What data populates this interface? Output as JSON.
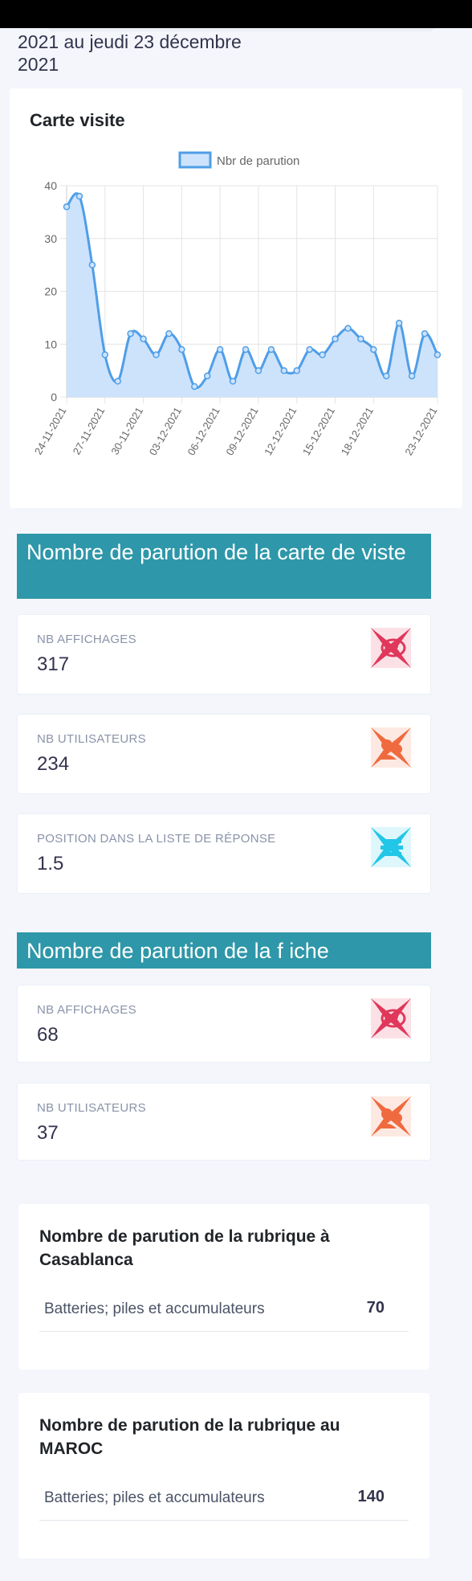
{
  "header": {
    "date_range": "2021 au jeudi 23 décembre 2021"
  },
  "visits_chart": {
    "title": "Carte visite",
    "legend_label": "Nbr de parution"
  },
  "chart_data": {
    "type": "area",
    "title": "Carte visite",
    "x": [
      "24-11-2021",
      "25-11-2021",
      "26-11-2021",
      "27-11-2021",
      "28-11-2021",
      "29-11-2021",
      "30-11-2021",
      "01-12-2021",
      "02-12-2021",
      "03-12-2021",
      "04-12-2021",
      "05-12-2021",
      "06-12-2021",
      "07-12-2021",
      "08-12-2021",
      "09-12-2021",
      "10-12-2021",
      "11-12-2021",
      "12-12-2021",
      "13-12-2021",
      "14-12-2021",
      "15-12-2021",
      "16-12-2021",
      "17-12-2021",
      "18-12-2021",
      "19-12-2021",
      "20-12-2021",
      "21-12-2021",
      "22-12-2021",
      "23-12-2021"
    ],
    "x_tick_labels": [
      "24-11-2021",
      "27-11-2021",
      "30-11-2021",
      "03-12-2021",
      "06-12-2021",
      "09-12-2021",
      "12-12-2021",
      "15-12-2021",
      "18-12-2021",
      "23-12-2021"
    ],
    "series": [
      {
        "name": "Nbr de parution",
        "values": [
          36,
          38,
          25,
          8,
          3,
          12,
          11,
          8,
          12,
          9,
          2,
          4,
          9,
          3,
          9,
          5,
          9,
          5,
          5,
          9,
          8,
          11,
          13,
          11,
          9,
          4,
          14,
          4,
          12,
          8
        ]
      }
    ],
    "ylim": [
      0,
      40
    ],
    "y_ticks": [
      0,
      10,
      20,
      30,
      40
    ],
    "grid": true,
    "legend_position": "top-center",
    "color": "#4f9ee8",
    "fill_color": "#cde3fb"
  },
  "carte_section": {
    "title": "Nombre de parution de la carte de viste",
    "stats": [
      {
        "label": "NB AFFICHAGES",
        "value": "317",
        "icon": "eye-icon",
        "icon_color": "#e0375b"
      },
      {
        "label": "NB UTILISATEURS",
        "value": "234",
        "icon": "users-icon",
        "icon_color": "#f06a3f"
      },
      {
        "label": "POSITION DANS LA LISTE DE RÉPONSE",
        "value": "1.5",
        "icon": "list-icon",
        "icon_color": "#22c6e6"
      }
    ]
  },
  "fiche_section": {
    "title": "Nombre de parution de la f iche",
    "stats": [
      {
        "label": "NB AFFICHAGES",
        "value": "68",
        "icon": "eye-icon",
        "icon_color": "#e0375b"
      },
      {
        "label": "NB UTILISATEURS",
        "value": "37",
        "icon": "users-icon",
        "icon_color": "#f06a3f"
      }
    ]
  },
  "rubrique_city": {
    "title": "Nombre de parution de la rubrique à Casablanca",
    "rows": [
      {
        "category": "Batteries; piles et accumulateurs",
        "count": "70"
      }
    ]
  },
  "rubrique_country": {
    "title": "Nombre de parution de la rubrique au MAROC",
    "rows": [
      {
        "category": "Batteries; piles et accumulateurs",
        "count": "140"
      }
    ]
  }
}
